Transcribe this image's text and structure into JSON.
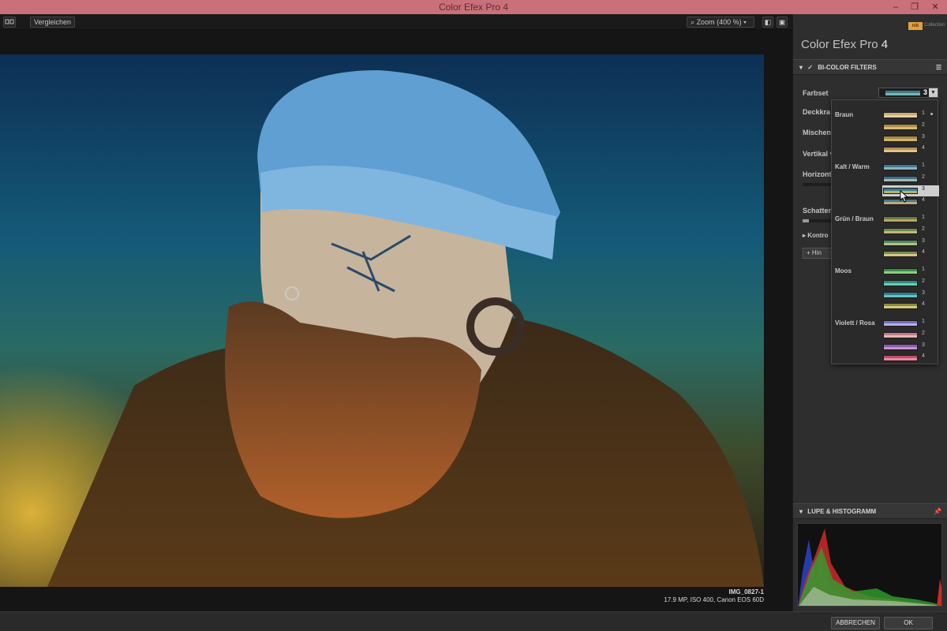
{
  "window": {
    "title": "Color Efex Pro 4",
    "controls": [
      "–",
      "❐",
      "✕"
    ]
  },
  "toolbar": {
    "compare_label": "Vergleichen",
    "zoom_label": "Zoom (400 %)"
  },
  "image": {
    "name": "IMG_0827-1",
    "meta": "17.9 MP, ISO 400, Canon EOS 60D"
  },
  "panel": {
    "app_name": "Color Efex Pro",
    "app_version": "4",
    "nik_badge": "nik",
    "nik_label": "Collection",
    "filter_section": "BI-COLOR FILTERS",
    "rows": {
      "farbset": "Farbset",
      "deckkraft": "Deckkra",
      "mischen": "Mischen",
      "vertikal": "Vertikal v",
      "horizont": "Horizont",
      "schatten": "Schatten",
      "kontrolle": "Kontro",
      "hinzu": "Hin"
    },
    "farbset_value": "3",
    "loupe_section": "LUPE & HISTOGRAMM"
  },
  "dropdown": {
    "groups": [
      {
        "label": "Braun",
        "options": [
          {
            "n": "1",
            "top": "#c7ac74",
            "bottom": "#e0cfa0"
          },
          {
            "n": "2",
            "top": "#b08a44",
            "bottom": "#d8bc78"
          },
          {
            "n": "3",
            "top": "#a88a40",
            "bottom": "#cdb46c"
          },
          {
            "n": "4",
            "top": "#b79050",
            "bottom": "#e0c48c"
          }
        ]
      },
      {
        "label": "Kalt / Warm",
        "options": [
          {
            "n": "1",
            "top": "#3c7a93",
            "bottom": "#8fb3b8"
          },
          {
            "n": "2",
            "top": "#3f6e8c",
            "bottom": "#a4b8ac"
          },
          {
            "n": "3",
            "top": "#3b7c8a",
            "bottom": "#b4b46c",
            "selected": true
          },
          {
            "n": "4",
            "top": "#4a7a88",
            "bottom": "#b7ad7c"
          }
        ]
      },
      {
        "label": "Grün / Braun",
        "options": [
          {
            "n": "1",
            "top": "#6b7a3a",
            "bottom": "#b9a66c"
          },
          {
            "n": "2",
            "top": "#6d8c4a",
            "bottom": "#c8b480"
          },
          {
            "n": "3",
            "top": "#4f8a5a",
            "bottom": "#b5c08a"
          },
          {
            "n": "4",
            "top": "#7b8a4c",
            "bottom": "#d4c48e"
          }
        ]
      },
      {
        "label": "Moos",
        "options": [
          {
            "n": "1",
            "top": "#3f8a4c",
            "bottom": "#8ccf7c"
          },
          {
            "n": "2",
            "top": "#2f8a7c",
            "bottom": "#6ccdb4"
          },
          {
            "n": "3",
            "top": "#2c7c8a",
            "bottom": "#6cc0c0"
          },
          {
            "n": "4",
            "top": "#8a8a40",
            "bottom": "#d4c87c"
          }
        ]
      },
      {
        "label": "Violett / Rosa",
        "options": [
          {
            "n": "1",
            "top": "#7a6cc0",
            "bottom": "#b4b0e8"
          },
          {
            "n": "2",
            "top": "#c07a8a",
            "bottom": "#e8b4b4"
          },
          {
            "n": "3",
            "top": "#8a5ab0",
            "bottom": "#c890c8"
          },
          {
            "n": "4",
            "top": "#c04a6a",
            "bottom": "#e8889c"
          }
        ]
      }
    ]
  },
  "footer": {
    "cancel": "ABBRECHEN",
    "ok": "OK"
  }
}
